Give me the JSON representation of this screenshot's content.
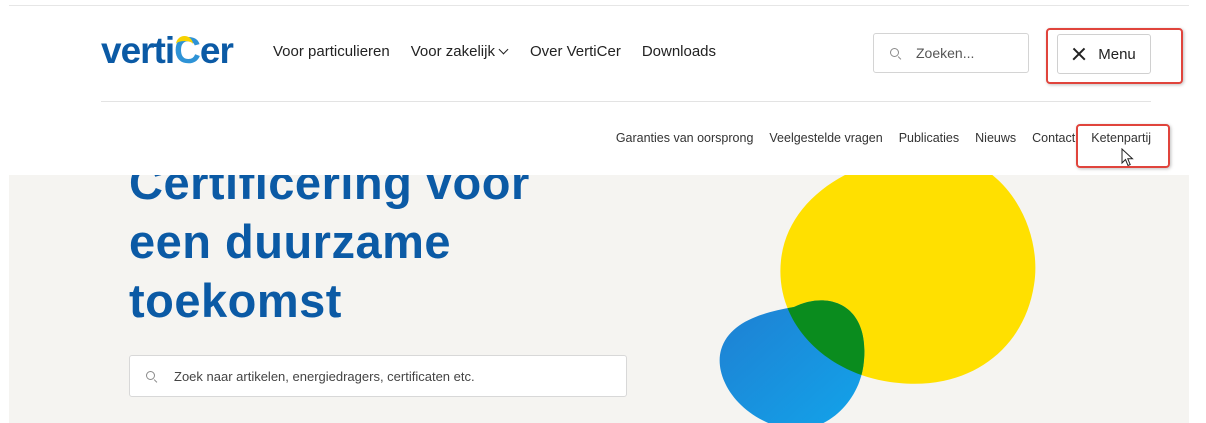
{
  "brand": {
    "logo_prefix": "verti",
    "logo_c": "C",
    "logo_suffix": "er",
    "logo_color": "#0b5aa5",
    "logo_accent_color": "#f7d200"
  },
  "main_nav": {
    "items": [
      {
        "label": "Voor particulieren"
      },
      {
        "label": "Voor zakelijk",
        "has_dropdown": true,
        "icon": "chevron-down-icon"
      },
      {
        "label": "Over VertiCer"
      },
      {
        "label": "Downloads"
      }
    ]
  },
  "search": {
    "placeholder": "Zoeken...",
    "icon": "search-icon"
  },
  "menu_button": {
    "label": "Menu",
    "icon": "close-icon"
  },
  "sub_nav": {
    "items": [
      {
        "label": "Garanties van oorsprong"
      },
      {
        "label": "Veelgestelde vragen"
      },
      {
        "label": "Publicaties"
      },
      {
        "label": "Nieuws"
      },
      {
        "label": "Contact"
      },
      {
        "label": "Ketenpartij"
      }
    ]
  },
  "hero": {
    "title_lines": [
      "Certificering voor",
      "een duurzame",
      "toekomst"
    ],
    "search_placeholder": "Zoek naar artikelen, energiedragers, certificaten etc.",
    "background": "#f5f4f1",
    "title_color": "#0b5aa5"
  },
  "colors": {
    "highlight": "#e0443c",
    "yellow_shape": "#ffe000",
    "blue_shape": "#1a8fdc",
    "overlap_shape": "#0a8c1e"
  }
}
